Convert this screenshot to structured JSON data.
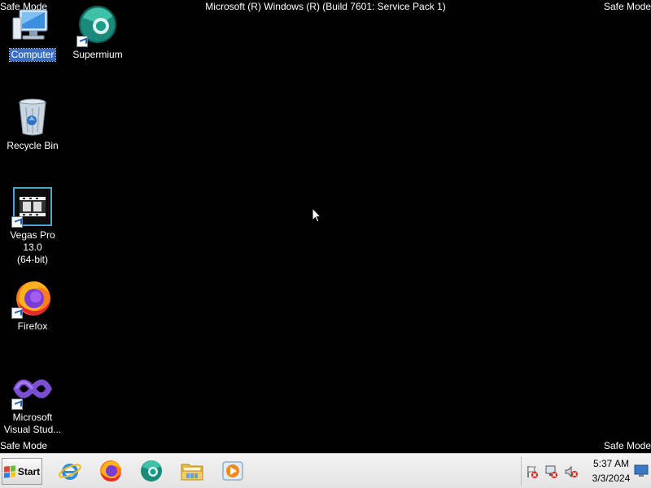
{
  "window": {
    "build_text": "Microsoft (R) Windows (R) (Build 7601: Service Pack 1)",
    "safe_mode_text": "Safe Mode"
  },
  "desktop_icons": [
    {
      "label": "Computer",
      "icon": "computer-icon",
      "selected": true
    },
    {
      "label": "Supermium",
      "icon": "supermium-icon",
      "shortcut": true
    },
    {
      "label": "Recycle Bin",
      "icon": "recycle-bin-icon"
    },
    {
      "label": "Vegas Pro 13.0 (64-bit)",
      "line1": "Vegas Pro 13.0",
      "line2": "(64-bit)",
      "icon": "vegas-pro-icon",
      "shortcut": true
    },
    {
      "label": "Firefox",
      "icon": "firefox-icon",
      "shortcut": true
    },
    {
      "label": "Microsoft Visual Stud...",
      "line1": "Microsoft",
      "line2": "Visual Stud...",
      "icon": "visual-studio-icon",
      "shortcut": true
    }
  ],
  "taskbar": {
    "start_label": "Start",
    "pinned": [
      {
        "name": "Internet Explorer",
        "icon": "internet-explorer-icon"
      },
      {
        "name": "Firefox",
        "icon": "firefox-icon"
      },
      {
        "name": "Supermium",
        "icon": "supermium-icon"
      },
      {
        "name": "Windows Explorer",
        "icon": "folder-icon"
      },
      {
        "name": "Windows Media Player",
        "icon": "media-player-icon"
      }
    ],
    "tray": {
      "icons": [
        "action-center-flag-icon",
        "network-error-icon",
        "volume-muted-icon"
      ],
      "time": "5:37 AM",
      "date": "3/3/2024"
    }
  },
  "colors": {
    "desktop_background": "#000000",
    "selection": "#3b6fc7",
    "taskbar": "#e9e9e9"
  }
}
